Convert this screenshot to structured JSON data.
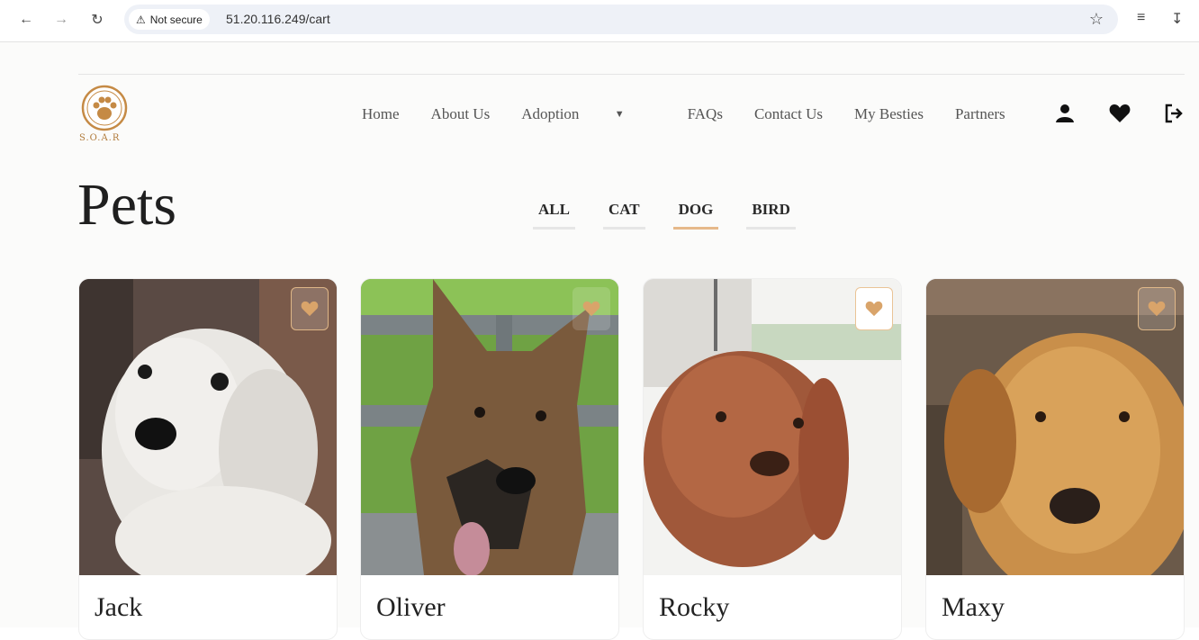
{
  "browser": {
    "secure_label": "Not secure",
    "url": "51.20.116.249/cart"
  },
  "site": {
    "logo_text": "S.O.A.R",
    "nav": [
      {
        "label": "Home"
      },
      {
        "label": "About Us"
      },
      {
        "label": "Adoption"
      },
      {
        "label": "FAQs"
      },
      {
        "label": "Contact Us"
      },
      {
        "label": "My Besties"
      },
      {
        "label": "Partners"
      }
    ],
    "accent_color": "#d9a46a"
  },
  "page": {
    "title": "Pets",
    "filters": [
      {
        "label": "ALL",
        "active": false
      },
      {
        "label": "CAT",
        "active": false
      },
      {
        "label": "DOG",
        "active": true
      },
      {
        "label": "BIRD",
        "active": false
      }
    ]
  },
  "pets": [
    {
      "name": "Jack"
    },
    {
      "name": "Oliver"
    },
    {
      "name": "Rocky"
    },
    {
      "name": "Maxy"
    }
  ]
}
